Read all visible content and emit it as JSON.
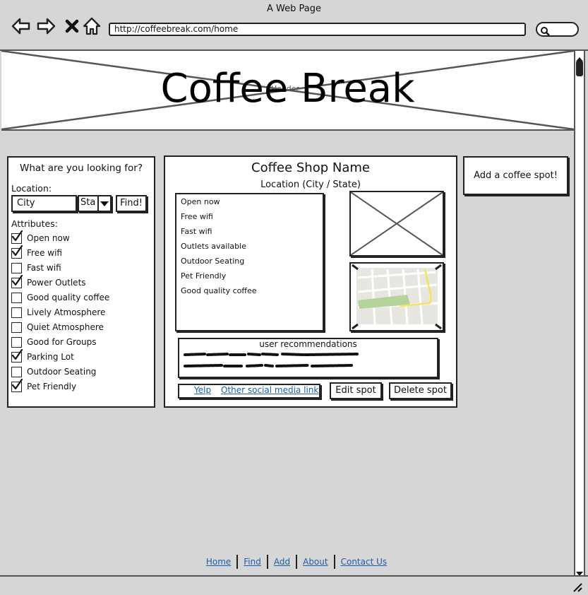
{
  "browser": {
    "window_title": "A Web Page",
    "url": "http://coffeebreak.com/home",
    "icons": [
      "back-arrow-icon",
      "forward-arrow-icon",
      "close-icon",
      "home-icon",
      "search-icon"
    ]
  },
  "header": {
    "title": "Coffee Break",
    "placeholder_label": "Header"
  },
  "search_panel": {
    "heading": "What are you looking for?",
    "location_label": "Location:",
    "city_value": "City",
    "state_value": "Sta",
    "find_label": "Find!",
    "attributes_label": "Attributes:",
    "attributes": [
      {
        "label": "Open now",
        "checked": true
      },
      {
        "label": "Free wifi",
        "checked": true
      },
      {
        "label": "Fast wifi",
        "checked": false
      },
      {
        "label": "Power Outlets",
        "checked": true
      },
      {
        "label": "Good quality coffee",
        "checked": false
      },
      {
        "label": "Lively Atmosphere",
        "checked": false
      },
      {
        "label": "Quiet Atmosphere",
        "checked": false
      },
      {
        "label": "Good for Groups",
        "checked": false
      },
      {
        "label": "Parking Lot",
        "checked": true
      },
      {
        "label": "Outdoor Seating",
        "checked": false
      },
      {
        "label": "Pet Friendly",
        "checked": true
      }
    ]
  },
  "details": {
    "shop_name": "Coffee Shop Name",
    "location": "Location (City / State)",
    "features": [
      "Open now",
      "Free wifi",
      "Fast wifi",
      "Outlets available",
      "Outdoor Seating",
      "Pet Friendly",
      "Good quality coffee"
    ],
    "recommendations_title": "user recommendations",
    "links": [
      "Yelp",
      "Other social media link"
    ],
    "edit_label": "Edit spot",
    "delete_label": "Delete spot"
  },
  "add_spot_label": "Add a coffee spot!",
  "footer": {
    "links": [
      "Home",
      "Find",
      "Add",
      "About",
      "Contact Us"
    ]
  },
  "colors": {
    "background": "#d6d6d6",
    "link": "#1d5fa8",
    "map_park": "#b5d49a",
    "map_road": "#f2e55a"
  }
}
